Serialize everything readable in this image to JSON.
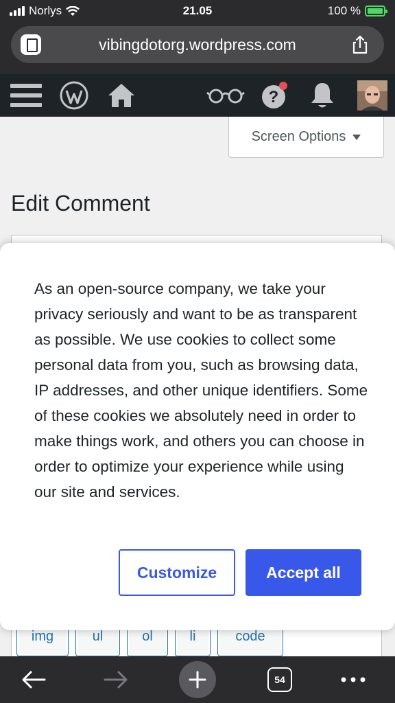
{
  "status_bar": {
    "carrier": "Norlys",
    "time": "21.05",
    "battery": "100 %"
  },
  "browser": {
    "url": "vibingdotorg.wordpress.com",
    "tab_count": "54"
  },
  "admin_bar": {
    "icons": [
      "menu-icon",
      "wordpress-icon",
      "home-icon",
      "glasses-icon",
      "help-icon",
      "bell-icon",
      "avatar"
    ]
  },
  "page": {
    "screen_options": "Screen Options",
    "title": "Edit Comment",
    "quicktags": [
      "img",
      "ul",
      "ol",
      "li",
      "code"
    ]
  },
  "cookie_banner": {
    "text": "As an open-source company, we take your privacy seriously and want to be as transparent as possible. We use cookies to collect some personal data from you, such as browsing data, IP addresses, and other unique identifiers. Some of these cookies we absolutely need in order to make things work, and others you can choose in order to optimize your experience while using our site and services.",
    "customize_label": "Customize",
    "accept_label": "Accept all"
  },
  "colors": {
    "accent": "#3858e9",
    "admin_bar": "#1d2327",
    "notification_dot": "#e65054"
  }
}
